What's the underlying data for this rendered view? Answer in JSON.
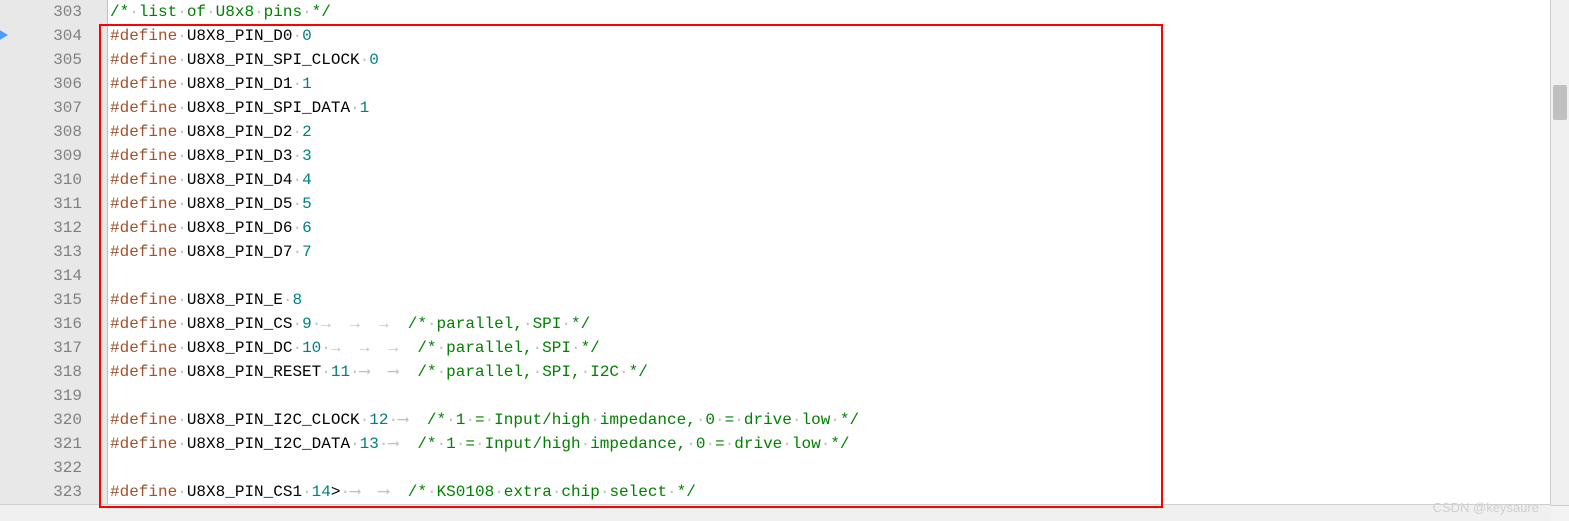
{
  "gutter": {
    "start": 303,
    "end": 323
  },
  "lines": [
    {
      "type": "comment",
      "text": "/* list of U8x8 pins */"
    },
    {
      "type": "define",
      "macro": "U8X8_PIN_D0",
      "value": "0"
    },
    {
      "type": "define",
      "macro": "U8X8_PIN_SPI_CLOCK",
      "value": "0"
    },
    {
      "type": "define",
      "macro": "U8X8_PIN_D1",
      "value": "1"
    },
    {
      "type": "define",
      "macro": "U8X8_PIN_SPI_DATA",
      "value": "1"
    },
    {
      "type": "define",
      "macro": "U8X8_PIN_D2",
      "value": "2"
    },
    {
      "type": "define",
      "macro": "U8X8_PIN_D3",
      "value": "3"
    },
    {
      "type": "define",
      "macro": "U8X8_PIN_D4",
      "value": "4"
    },
    {
      "type": "define",
      "macro": "U8X8_PIN_D5",
      "value": "5"
    },
    {
      "type": "define",
      "macro": "U8X8_PIN_D6",
      "value": "6"
    },
    {
      "type": "define",
      "macro": "U8X8_PIN_D7",
      "value": "7"
    },
    {
      "type": "blank"
    },
    {
      "type": "define",
      "macro": "U8X8_PIN_E",
      "value": "8"
    },
    {
      "type": "define",
      "macro": "U8X8_PIN_CS",
      "value": "9",
      "tabs": 3,
      "tabchar": "→",
      "comment": "/* parallel, SPI */"
    },
    {
      "type": "define",
      "macro": "U8X8_PIN_DC",
      "value": "10",
      "tabs": 3,
      "tabchar": "→",
      "comment": "/* parallel, SPI */"
    },
    {
      "type": "define",
      "macro": "U8X8_PIN_RESET",
      "value": "11",
      "tabs": 2,
      "tabchar": "⟶",
      "comment": "/* parallel, SPI, I2C */"
    },
    {
      "type": "blank"
    },
    {
      "type": "define",
      "macro": "U8X8_PIN_I2C_CLOCK",
      "value": "12",
      "tabs": 1,
      "tabchar": "⟶",
      "comment": "/* 1 = Input/high impedance, 0 = drive low */"
    },
    {
      "type": "define",
      "macro": "U8X8_PIN_I2C_DATA",
      "value": "13",
      "tabs": 1,
      "tabchar": "⟶",
      "comment": "/* 1 = Input/high impedance, 0 = drive low */"
    },
    {
      "type": "blank"
    },
    {
      "type": "define",
      "macro": "U8X8_PIN_CS1",
      "value": "14",
      "post": ">",
      "tabs": 2,
      "tabchar": "⟶",
      "comment": "/* KS0108 extra chip select */"
    }
  ],
  "watermark": "CSDN @keysaure"
}
